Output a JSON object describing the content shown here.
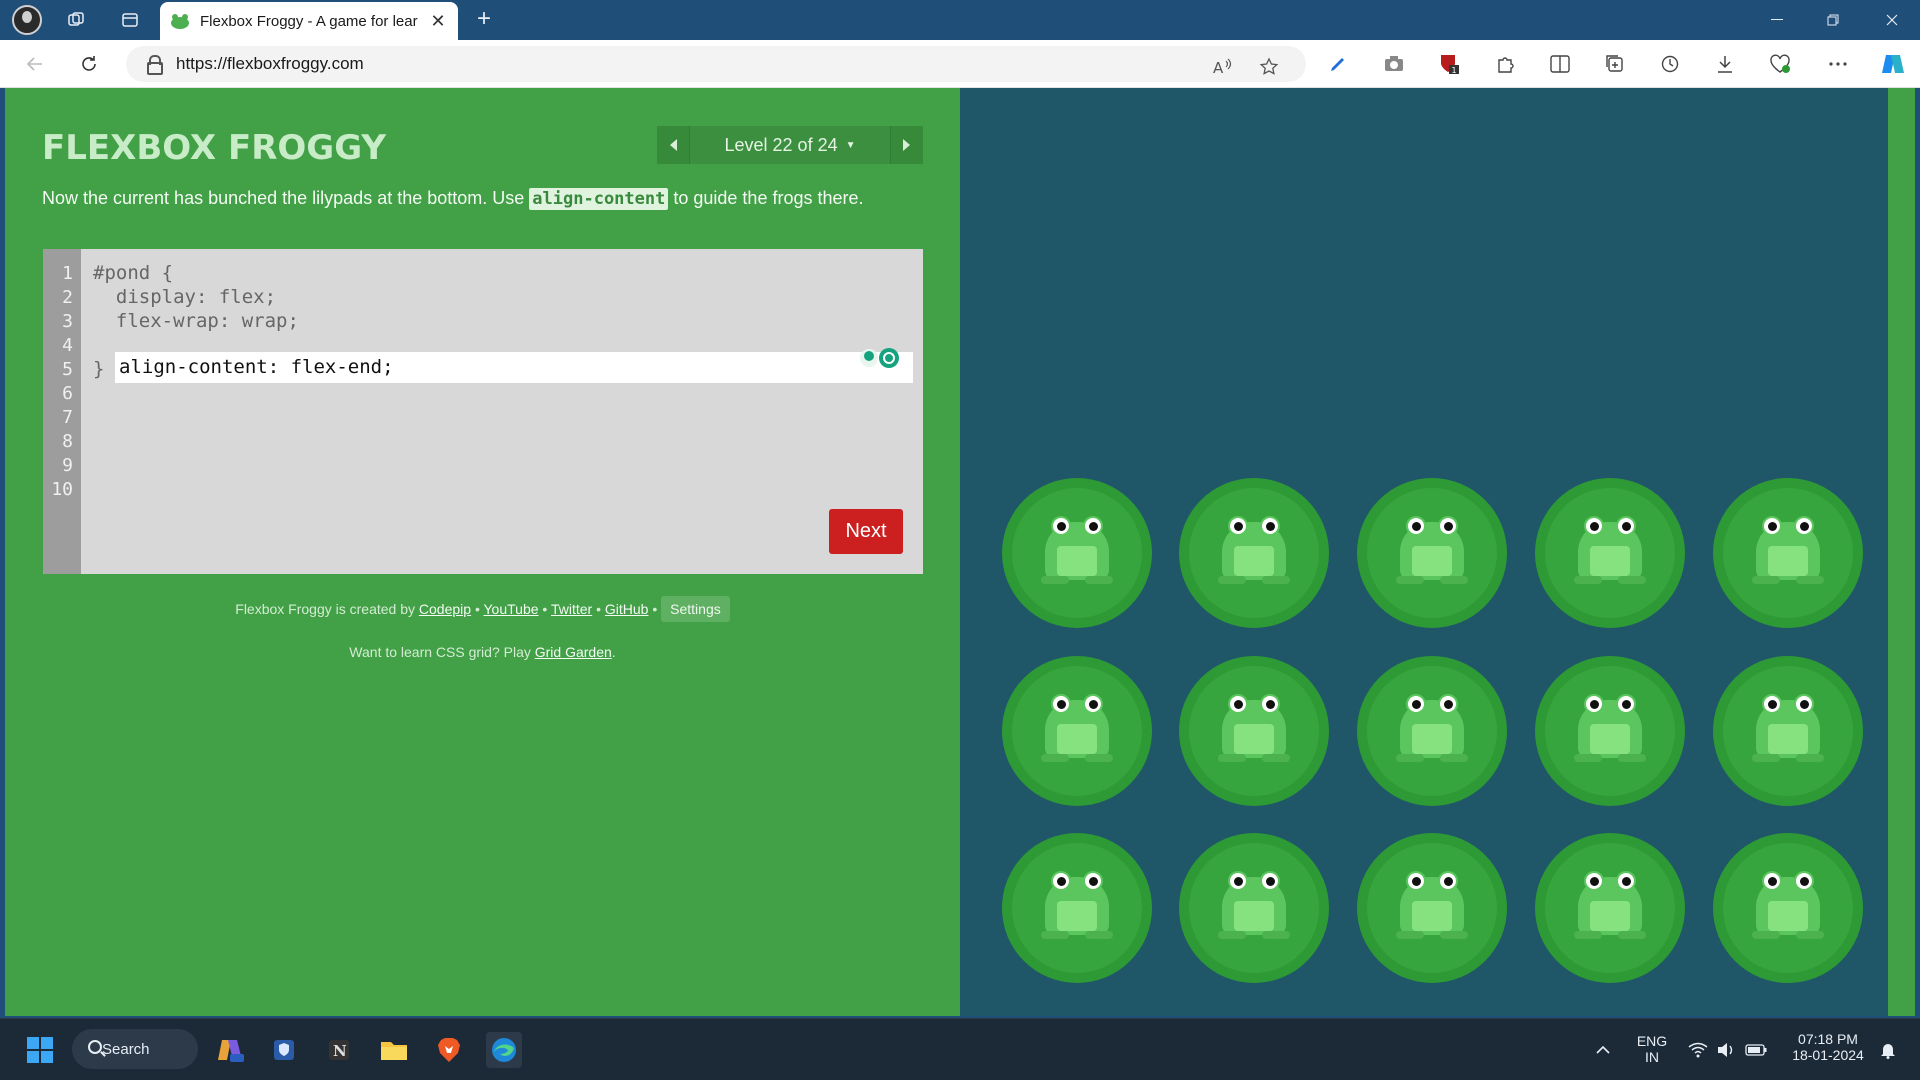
{
  "browser": {
    "tab_title": "Flexbox Froggy - A game for lear",
    "url": "https://flexboxfroggy.com",
    "new_tab_symbol": "+",
    "close_symbol": "✕"
  },
  "game": {
    "logo": "FLEXBOX FROGGY",
    "level_label": "Level 22 of 24",
    "instructions_before": "Now the current has bunched the lilypads at the bottom. Use",
    "instructions_keyword": "align-content",
    "instructions_after": "to guide the frogs there.",
    "line_numbers": [
      "1",
      "2",
      "3",
      "4",
      "5",
      "6",
      "7",
      "8",
      "9",
      "10"
    ],
    "code_lines": [
      "#pond {",
      "  display: flex;",
      "  flex-wrap: wrap;",
      "",
      "}"
    ],
    "input_value": "align-content: flex-end;",
    "next_label": "Next",
    "footer": {
      "created_by": "Flexbox Froggy is created by",
      "codepip": "Codepip",
      "youtube": "YouTube",
      "twitter": "Twitter",
      "github": "GitHub",
      "settings": "Settings",
      "grid_prompt": "Want to learn CSS grid? Play",
      "grid_garden": "Grid Garden",
      "bullet": "•",
      "period": "."
    }
  },
  "taskbar": {
    "search_label": "Search",
    "lang_top": "ENG",
    "lang_bottom": "IN",
    "time": "07:18 PM",
    "date": "18-01-2024"
  },
  "colors": {
    "game_green": "#42a047",
    "pond_blue": "#1f5768",
    "next_red": "#cc1f1f",
    "titlebar": "#1f4e79"
  }
}
